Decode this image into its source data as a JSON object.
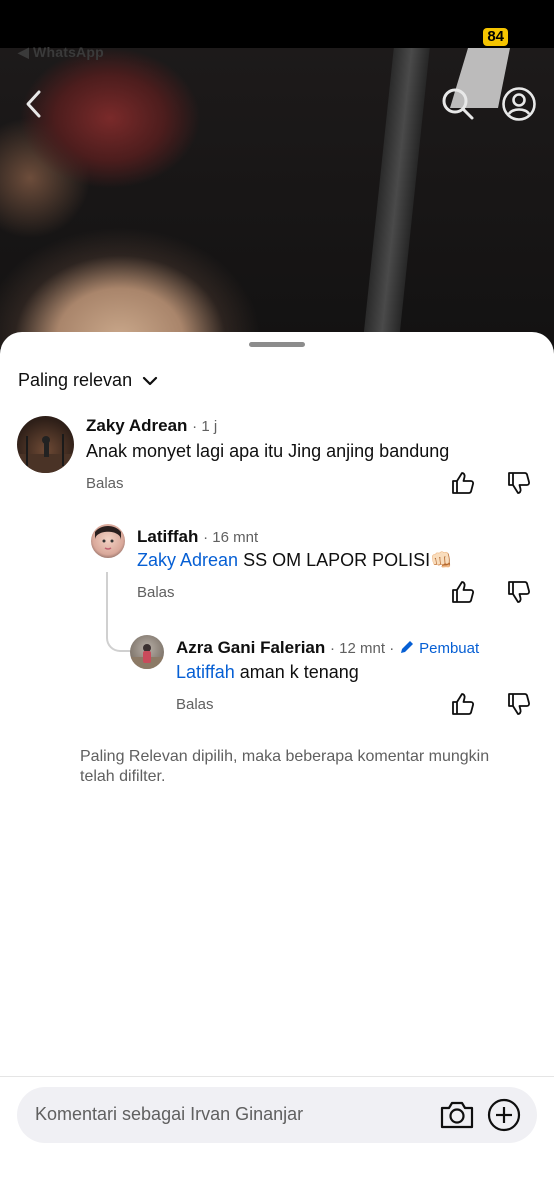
{
  "status_bar": {
    "back_app": "◀ WhatsApp",
    "battery": "84"
  },
  "sheet": {
    "sort_label": "Paling relevan",
    "comments": [
      {
        "author": "Zaky Adrean",
        "time": "· 1 j",
        "text": "Anak monyet lagi apa itu Jing anjing bandung",
        "reply": "Balas"
      },
      {
        "author": "Latiffah",
        "time": "· 16 mnt",
        "mention": "Zaky Adrean",
        "text": " SS OM LAPOR POLISI👊🏻",
        "reply": "Balas"
      },
      {
        "author": "Azra Gani Falerian",
        "time": "· 12 mnt ·",
        "creator_badge": "Pembuat",
        "mention": "Latiffah",
        "text": " aman k tenang",
        "reply": "Balas"
      }
    ],
    "filter_note": "Paling Relevan dipilih, maka beberapa komentar mungkin telah difilter.",
    "composer_placeholder": "Komentari sebagai Irvan Ginanjar"
  },
  "colors": {
    "mention": "#065fd4",
    "battery": "#f5c400",
    "secondary_text": "#606060"
  }
}
